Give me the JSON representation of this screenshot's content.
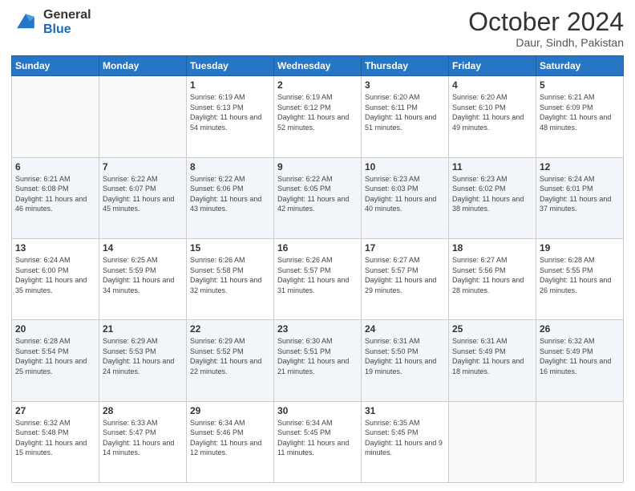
{
  "header": {
    "logo_line1": "General",
    "logo_line2": "Blue",
    "month": "October 2024",
    "location": "Daur, Sindh, Pakistan"
  },
  "days_of_week": [
    "Sunday",
    "Monday",
    "Tuesday",
    "Wednesday",
    "Thursday",
    "Friday",
    "Saturday"
  ],
  "weeks": [
    [
      {
        "day": "",
        "sunrise": "",
        "sunset": "",
        "daylight": ""
      },
      {
        "day": "",
        "sunrise": "",
        "sunset": "",
        "daylight": ""
      },
      {
        "day": "1",
        "sunrise": "Sunrise: 6:19 AM",
        "sunset": "Sunset: 6:13 PM",
        "daylight": "Daylight: 11 hours and 54 minutes."
      },
      {
        "day": "2",
        "sunrise": "Sunrise: 6:19 AM",
        "sunset": "Sunset: 6:12 PM",
        "daylight": "Daylight: 11 hours and 52 minutes."
      },
      {
        "day": "3",
        "sunrise": "Sunrise: 6:20 AM",
        "sunset": "Sunset: 6:11 PM",
        "daylight": "Daylight: 11 hours and 51 minutes."
      },
      {
        "day": "4",
        "sunrise": "Sunrise: 6:20 AM",
        "sunset": "Sunset: 6:10 PM",
        "daylight": "Daylight: 11 hours and 49 minutes."
      },
      {
        "day": "5",
        "sunrise": "Sunrise: 6:21 AM",
        "sunset": "Sunset: 6:09 PM",
        "daylight": "Daylight: 11 hours and 48 minutes."
      }
    ],
    [
      {
        "day": "6",
        "sunrise": "Sunrise: 6:21 AM",
        "sunset": "Sunset: 6:08 PM",
        "daylight": "Daylight: 11 hours and 46 minutes."
      },
      {
        "day": "7",
        "sunrise": "Sunrise: 6:22 AM",
        "sunset": "Sunset: 6:07 PM",
        "daylight": "Daylight: 11 hours and 45 minutes."
      },
      {
        "day": "8",
        "sunrise": "Sunrise: 6:22 AM",
        "sunset": "Sunset: 6:06 PM",
        "daylight": "Daylight: 11 hours and 43 minutes."
      },
      {
        "day": "9",
        "sunrise": "Sunrise: 6:22 AM",
        "sunset": "Sunset: 6:05 PM",
        "daylight": "Daylight: 11 hours and 42 minutes."
      },
      {
        "day": "10",
        "sunrise": "Sunrise: 6:23 AM",
        "sunset": "Sunset: 6:03 PM",
        "daylight": "Daylight: 11 hours and 40 minutes."
      },
      {
        "day": "11",
        "sunrise": "Sunrise: 6:23 AM",
        "sunset": "Sunset: 6:02 PM",
        "daylight": "Daylight: 11 hours and 38 minutes."
      },
      {
        "day": "12",
        "sunrise": "Sunrise: 6:24 AM",
        "sunset": "Sunset: 6:01 PM",
        "daylight": "Daylight: 11 hours and 37 minutes."
      }
    ],
    [
      {
        "day": "13",
        "sunrise": "Sunrise: 6:24 AM",
        "sunset": "Sunset: 6:00 PM",
        "daylight": "Daylight: 11 hours and 35 minutes."
      },
      {
        "day": "14",
        "sunrise": "Sunrise: 6:25 AM",
        "sunset": "Sunset: 5:59 PM",
        "daylight": "Daylight: 11 hours and 34 minutes."
      },
      {
        "day": "15",
        "sunrise": "Sunrise: 6:26 AM",
        "sunset": "Sunset: 5:58 PM",
        "daylight": "Daylight: 11 hours and 32 minutes."
      },
      {
        "day": "16",
        "sunrise": "Sunrise: 6:26 AM",
        "sunset": "Sunset: 5:57 PM",
        "daylight": "Daylight: 11 hours and 31 minutes."
      },
      {
        "day": "17",
        "sunrise": "Sunrise: 6:27 AM",
        "sunset": "Sunset: 5:57 PM",
        "daylight": "Daylight: 11 hours and 29 minutes."
      },
      {
        "day": "18",
        "sunrise": "Sunrise: 6:27 AM",
        "sunset": "Sunset: 5:56 PM",
        "daylight": "Daylight: 11 hours and 28 minutes."
      },
      {
        "day": "19",
        "sunrise": "Sunrise: 6:28 AM",
        "sunset": "Sunset: 5:55 PM",
        "daylight": "Daylight: 11 hours and 26 minutes."
      }
    ],
    [
      {
        "day": "20",
        "sunrise": "Sunrise: 6:28 AM",
        "sunset": "Sunset: 5:54 PM",
        "daylight": "Daylight: 11 hours and 25 minutes."
      },
      {
        "day": "21",
        "sunrise": "Sunrise: 6:29 AM",
        "sunset": "Sunset: 5:53 PM",
        "daylight": "Daylight: 11 hours and 24 minutes."
      },
      {
        "day": "22",
        "sunrise": "Sunrise: 6:29 AM",
        "sunset": "Sunset: 5:52 PM",
        "daylight": "Daylight: 11 hours and 22 minutes."
      },
      {
        "day": "23",
        "sunrise": "Sunrise: 6:30 AM",
        "sunset": "Sunset: 5:51 PM",
        "daylight": "Daylight: 11 hours and 21 minutes."
      },
      {
        "day": "24",
        "sunrise": "Sunrise: 6:31 AM",
        "sunset": "Sunset: 5:50 PM",
        "daylight": "Daylight: 11 hours and 19 minutes."
      },
      {
        "day": "25",
        "sunrise": "Sunrise: 6:31 AM",
        "sunset": "Sunset: 5:49 PM",
        "daylight": "Daylight: 11 hours and 18 minutes."
      },
      {
        "day": "26",
        "sunrise": "Sunrise: 6:32 AM",
        "sunset": "Sunset: 5:49 PM",
        "daylight": "Daylight: 11 hours and 16 minutes."
      }
    ],
    [
      {
        "day": "27",
        "sunrise": "Sunrise: 6:32 AM",
        "sunset": "Sunset: 5:48 PM",
        "daylight": "Daylight: 11 hours and 15 minutes."
      },
      {
        "day": "28",
        "sunrise": "Sunrise: 6:33 AM",
        "sunset": "Sunset: 5:47 PM",
        "daylight": "Daylight: 11 hours and 14 minutes."
      },
      {
        "day": "29",
        "sunrise": "Sunrise: 6:34 AM",
        "sunset": "Sunset: 5:46 PM",
        "daylight": "Daylight: 11 hours and 12 minutes."
      },
      {
        "day": "30",
        "sunrise": "Sunrise: 6:34 AM",
        "sunset": "Sunset: 5:45 PM",
        "daylight": "Daylight: 11 hours and 11 minutes."
      },
      {
        "day": "31",
        "sunrise": "Sunrise: 6:35 AM",
        "sunset": "Sunset: 5:45 PM",
        "daylight": "Daylight: 11 hours and 9 minutes."
      },
      {
        "day": "",
        "sunrise": "",
        "sunset": "",
        "daylight": ""
      },
      {
        "day": "",
        "sunrise": "",
        "sunset": "",
        "daylight": ""
      }
    ]
  ]
}
